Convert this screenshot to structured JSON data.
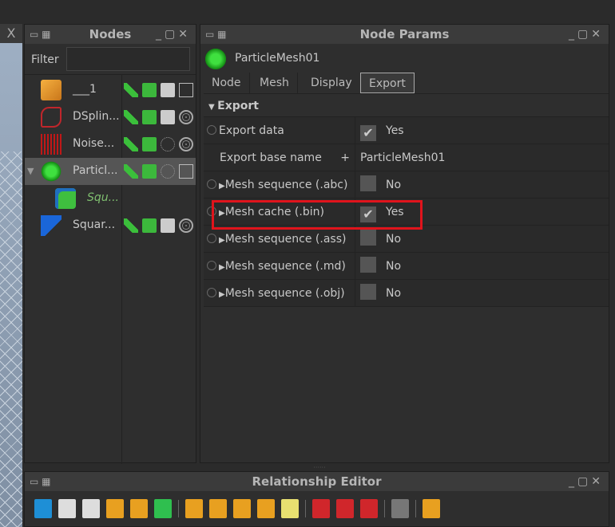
{
  "viewport": {
    "close_label": "X"
  },
  "nodes_panel": {
    "title": "Nodes",
    "filter_label": "Filter",
    "filter_value": "",
    "items": [
      {
        "name": "___1",
        "icon": "cube-orange-icon",
        "italic": false,
        "flags": [
          "render-icon",
          "save-icon",
          "shaded-icon",
          "wireframe-box-icon"
        ]
      },
      {
        "name": "DSplin...",
        "icon": "spline-icon",
        "italic": false,
        "flags": [
          "render-icon",
          "save-icon",
          "shaded-icon",
          "mesh-sphere-icon"
        ]
      },
      {
        "name": "Noise...",
        "icon": "noise-icon",
        "italic": false,
        "flags": [
          "render-icon",
          "save-icon",
          "dotted-icon",
          "mesh-sphere-icon"
        ]
      },
      {
        "name": "Particl...",
        "icon": "particle-icon",
        "italic": false,
        "flags": [
          "render-icon",
          "save-icon",
          "dotted-icon",
          "wireframe-box-icon"
        ]
      },
      {
        "name": "Squ...",
        "icon": "square-child-icon",
        "italic": true,
        "flags": []
      },
      {
        "name": "Squar...",
        "icon": "square-emitter-icon",
        "italic": false,
        "flags": [
          "render-icon",
          "save-icon",
          "shaded-icon",
          "mesh-sphere-icon"
        ]
      }
    ]
  },
  "params_panel": {
    "title": "Node Params",
    "node_name": "ParticleMesh01",
    "tabs": [
      "Node",
      "Mesh",
      "Display",
      "Export"
    ],
    "active_tab": "Export",
    "section": "Export",
    "rows": [
      {
        "label": "Export data",
        "value": "Yes",
        "checked": true,
        "radio": true,
        "expand": false
      },
      {
        "label": "Export base name",
        "value": "ParticleMesh01",
        "plus": "+",
        "radio": false,
        "expand": false
      },
      {
        "label": "Mesh sequence (.abc)",
        "value": "No",
        "checked": false,
        "radio": true,
        "expand": true
      },
      {
        "label": "Mesh cache (.bin)",
        "value": "Yes",
        "checked": true,
        "radio": true,
        "expand": true,
        "highlighted": true
      },
      {
        "label": "Mesh sequence (.ass)",
        "value": "No",
        "checked": false,
        "radio": true,
        "expand": true
      },
      {
        "label": "Mesh sequence (.md)",
        "value": "No",
        "checked": false,
        "radio": true,
        "expand": true
      },
      {
        "label": "Mesh sequence (.obj)",
        "value": "No",
        "checked": false,
        "radio": true,
        "expand": true
      }
    ],
    "highlight_color": "#e0141c"
  },
  "relationship_editor": {
    "title": "Relationship Editor",
    "tools": [
      "add-world-icon",
      "add-clock-icon",
      "add-image-icon",
      "remove-left-icon",
      "remove-right-icon",
      "remove-linked-icon",
      "|",
      "view-all-icon",
      "view-selected-icon",
      "view-connected-icon",
      "align-icon",
      "add-note-icon",
      "|",
      "link-icon",
      "unlink-icon",
      "graph-icon",
      "|",
      "grid-layout-icon",
      "|",
      "tree-icon"
    ]
  }
}
